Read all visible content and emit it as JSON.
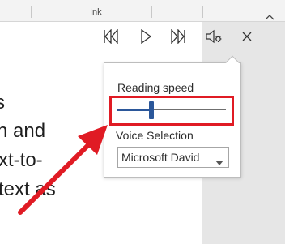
{
  "ribbon": {
    "group_label": "Ink"
  },
  "document": {
    "lines": [
      "s",
      "n and",
      "xt-to-",
      "text as"
    ]
  },
  "toolbar": {
    "previous": "previous-paragraph-icon",
    "play": "play-icon",
    "next": "next-paragraph-icon",
    "settings": "read-aloud-settings-icon",
    "close": "close-icon"
  },
  "popup": {
    "reading_speed_label": "Reading speed",
    "reading_speed_value": 0.31,
    "voice_label": "Voice Selection",
    "voice_selected": "Microsoft David"
  },
  "colors": {
    "accent": "#2b579a",
    "highlight": "#e01b24"
  }
}
